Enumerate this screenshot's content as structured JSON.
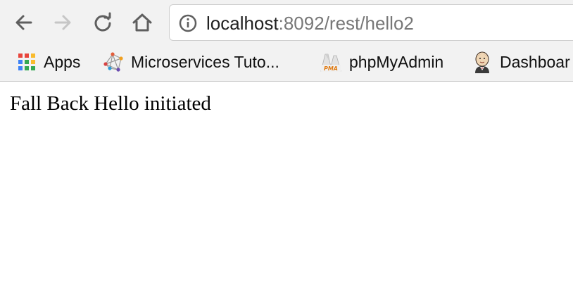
{
  "toolbar": {
    "back_icon": "back-arrow-icon",
    "forward_icon": "forward-arrow-icon",
    "reload_icon": "reload-icon",
    "home_icon": "home-icon"
  },
  "address_bar": {
    "host": "localhost",
    "rest": ":8092/rest/hello2",
    "info_icon": "info-icon"
  },
  "bookmarks": [
    {
      "label": "Apps",
      "icon": "apps-grid-icon"
    },
    {
      "label": "Microservices Tuto...",
      "icon": "network-graph-icon"
    },
    {
      "label": "phpMyAdmin",
      "icon": "phpmyadmin-icon"
    },
    {
      "label": "Dashboar",
      "icon": "jenkins-icon"
    }
  ],
  "page": {
    "body_text": "Fall Back Hello initiated"
  }
}
